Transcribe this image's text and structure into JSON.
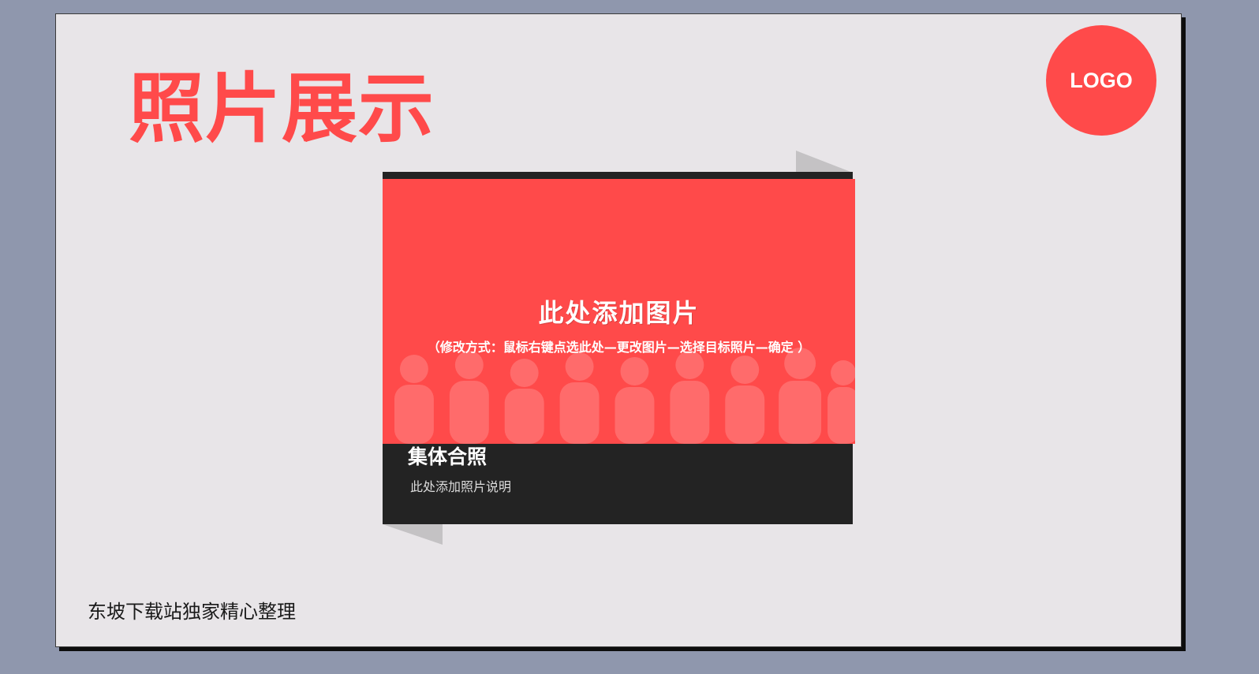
{
  "colors": {
    "accent": "#ff4a4a",
    "background_outer": "#8f97ad",
    "slide": "#e8e5e8",
    "card_dark": "#232323"
  },
  "slide": {
    "title": "照片展示",
    "logo_text": "LOGO",
    "footer": "东坡下载站独家精心整理"
  },
  "photo_card": {
    "placeholder_main": "此处添加图片",
    "placeholder_hint": "（修改方式：鼠标右键点选此处—更改图片—选择目标照片—确定 ）",
    "caption_title": "集体合照",
    "caption_desc": "此处添加照片说明"
  }
}
